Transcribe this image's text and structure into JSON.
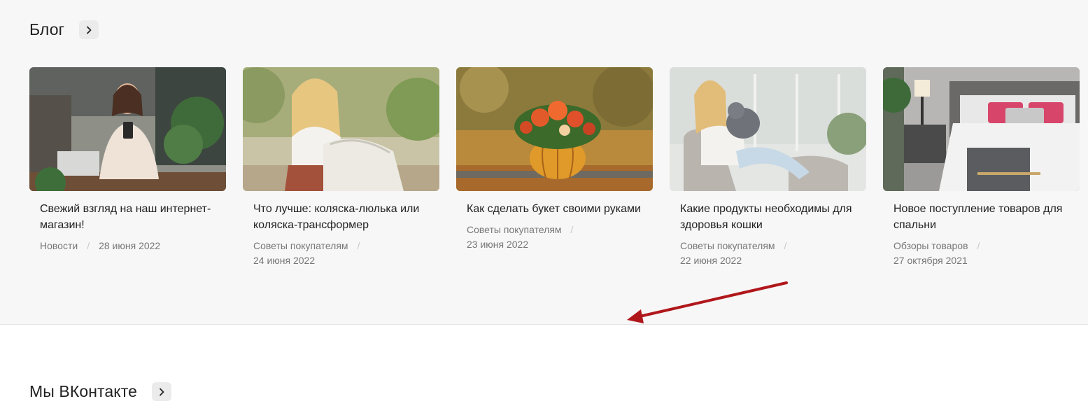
{
  "blog": {
    "title": "Блог",
    "arrow_icon": "chevron-right-icon",
    "cards": [
      {
        "title": "Свежий взгляд на наш интернет-магазин!",
        "category": "Новости",
        "date": "28 июня 2022"
      },
      {
        "title": "Что лучше: коляска-люлька или коляска-трансформер",
        "category": "Советы покупателям",
        "date": "24 июня 2022"
      },
      {
        "title": "Как сделать букет своими руками",
        "category": "Советы покупателям",
        "date": "23 июня 2022"
      },
      {
        "title": "Какие продукты необходимы для здоровья кошки",
        "category": "Советы покупателям",
        "date": "22 июня 2022"
      },
      {
        "title": "Новое поступление товаров для спальни",
        "category": "Обзоры товаров",
        "date": "27 октября 2021"
      }
    ]
  },
  "vk": {
    "title": "Мы ВКонтакте",
    "arrow_icon": "chevron-right-icon"
  },
  "colors": {
    "section_bg": "#f7f7f7",
    "annotation_arrow": "#b0171b"
  }
}
